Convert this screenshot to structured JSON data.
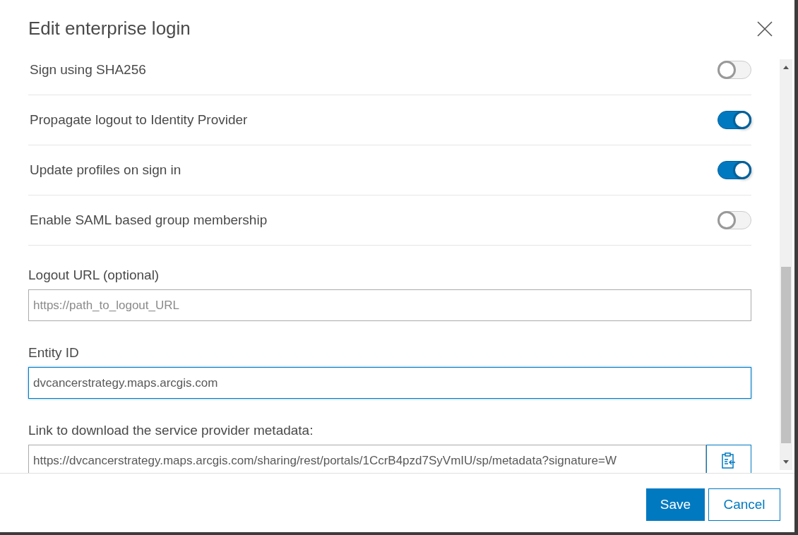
{
  "dialog": {
    "title": "Edit enterprise login"
  },
  "toggles": [
    {
      "label": "Sign using SHA256",
      "on": false
    },
    {
      "label": "Propagate logout to Identity Provider",
      "on": true
    },
    {
      "label": "Update profiles on sign in",
      "on": true
    },
    {
      "label": "Enable SAML based group membership",
      "on": false
    }
  ],
  "fields": [
    {
      "kind": "text",
      "label": "Logout URL (optional)",
      "placeholder": "https://path_to_logout_URL",
      "focused": false
    },
    {
      "kind": "text",
      "label": "Entity ID",
      "value": "dvcancerstrategy.maps.arcgis.com",
      "focused": true
    },
    {
      "kind": "copy",
      "label": "Link to download the service provider metadata:",
      "value": "https://dvcancerstrategy.maps.arcgis.com/sharing/rest/portals/1CcrB4pzd7SyVmIU/sp/metadata?signature=W",
      "focused": false
    }
  ],
  "buttons": [
    {
      "kind": "primary",
      "label": "Save"
    },
    {
      "kind": "secondary",
      "label": "Cancel"
    }
  ]
}
